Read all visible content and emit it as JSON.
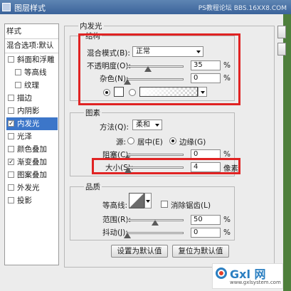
{
  "window": {
    "title": "图层样式",
    "watermark": "PS教程论坛 BBS.16XX8.COM"
  },
  "left_panel": {
    "styles_label": "样式",
    "blend_options_label": "混合选项:默认",
    "items": [
      {
        "label": "斜面和浮雕",
        "checked": false
      },
      {
        "label": "等高线",
        "checked": false
      },
      {
        "label": "纹理",
        "checked": false
      },
      {
        "label": "描边",
        "checked": false
      },
      {
        "label": "内阴影",
        "checked": false
      },
      {
        "label": "内发光",
        "checked": true
      },
      {
        "label": "光泽",
        "checked": false
      },
      {
        "label": "颜色叠加",
        "checked": false
      },
      {
        "label": "渐变叠加",
        "checked": true
      },
      {
        "label": "图案叠加",
        "checked": false
      },
      {
        "label": "外发光",
        "checked": false
      },
      {
        "label": "投影",
        "checked": false
      }
    ]
  },
  "main": {
    "panel_title": "内发光",
    "structure": {
      "title": "结构",
      "blend_mode_label": "混合模式(B):",
      "blend_mode_value": "正常",
      "opacity_label": "不透明度(O):",
      "opacity_value": "35",
      "opacity_unit": "%",
      "opacity_level": 0.35,
      "noise_label": "杂色(N):",
      "noise_value": "0",
      "noise_unit": "%",
      "noise_level": 0
    },
    "elements": {
      "title": "图素",
      "technique_label": "方法(Q):",
      "technique_value": "柔和",
      "source_label": "源:",
      "source_center_label": "居中(E)",
      "source_edge_label": "边缘(G)",
      "choke_label": "阻塞(C):",
      "choke_value": "0",
      "choke_unit": "%",
      "choke_level": 0,
      "size_label": "大小(S):",
      "size_value": "4",
      "size_unit": "像素",
      "size_level": 0.02
    },
    "quality": {
      "title": "品质",
      "contour_label": "等高线:",
      "anti_alias_label": "消除锯齿(L)",
      "range_label": "范围(R):",
      "range_value": "50",
      "range_unit": "%",
      "range_level": 0.5,
      "jitter_label": "抖动(J):",
      "jitter_value": "0",
      "jitter_unit": "%",
      "jitter_level": 0
    },
    "set_default_label": "设置为默认值",
    "reset_default_label": "复位为默认值"
  },
  "colors": {
    "highlight_red": "#e02323",
    "selection_blue": "#3c76c9",
    "title_blue": "#4a72a8"
  },
  "logo": {
    "brand": "Gxl 网",
    "site": "www.gxlsystem.com"
  }
}
